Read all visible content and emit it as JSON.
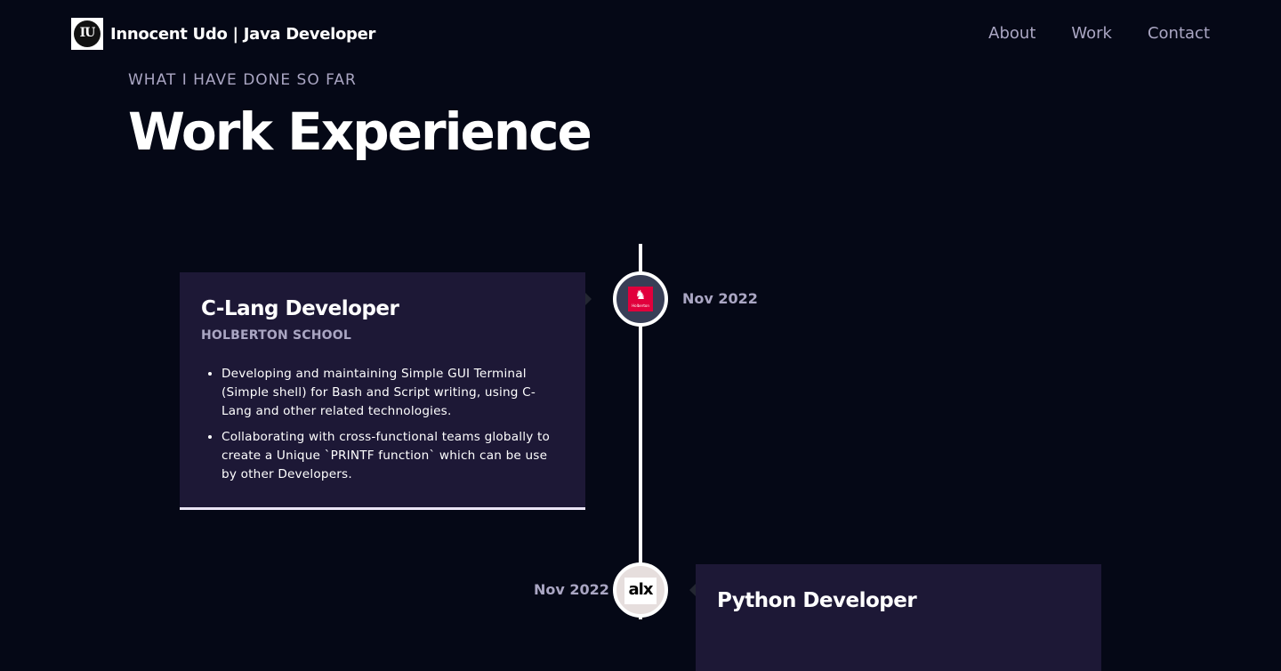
{
  "nav": {
    "logo_text": "IU",
    "brand": "Innocent Udo  | Java Developer",
    "links": [
      "About",
      "Work",
      "Contact"
    ]
  },
  "section": {
    "subtitle": "What I have done so far",
    "title": "Work Experience"
  },
  "experiences": [
    {
      "title": "C-Lang Developer",
      "company": "HOLBERTON SCHOOL",
      "date": "Nov 2022",
      "icon": "holberton-logo",
      "icon_text": "Holberton",
      "icon_bg": "#383e56",
      "points": [
        "Developing and maintaining Simple GUI Terminal (Simple shell) for Bash and Script writing, using C-Lang and other related technologies.",
        "Collaborating with cross-functional teams globally to create a Unique `PRINTF function` which can be use by other Developers."
      ]
    },
    {
      "title": "Python Developer",
      "company": "",
      "date": "Nov 2022",
      "icon": "alx-logo",
      "icon_text": "alx",
      "icon_bg": "#e6dedd",
      "points": []
    }
  ],
  "colors": {
    "background": "#050816",
    "card": "#1d1836",
    "secondary_text": "#aaa6c3",
    "holberton_red": "#e1003c"
  }
}
